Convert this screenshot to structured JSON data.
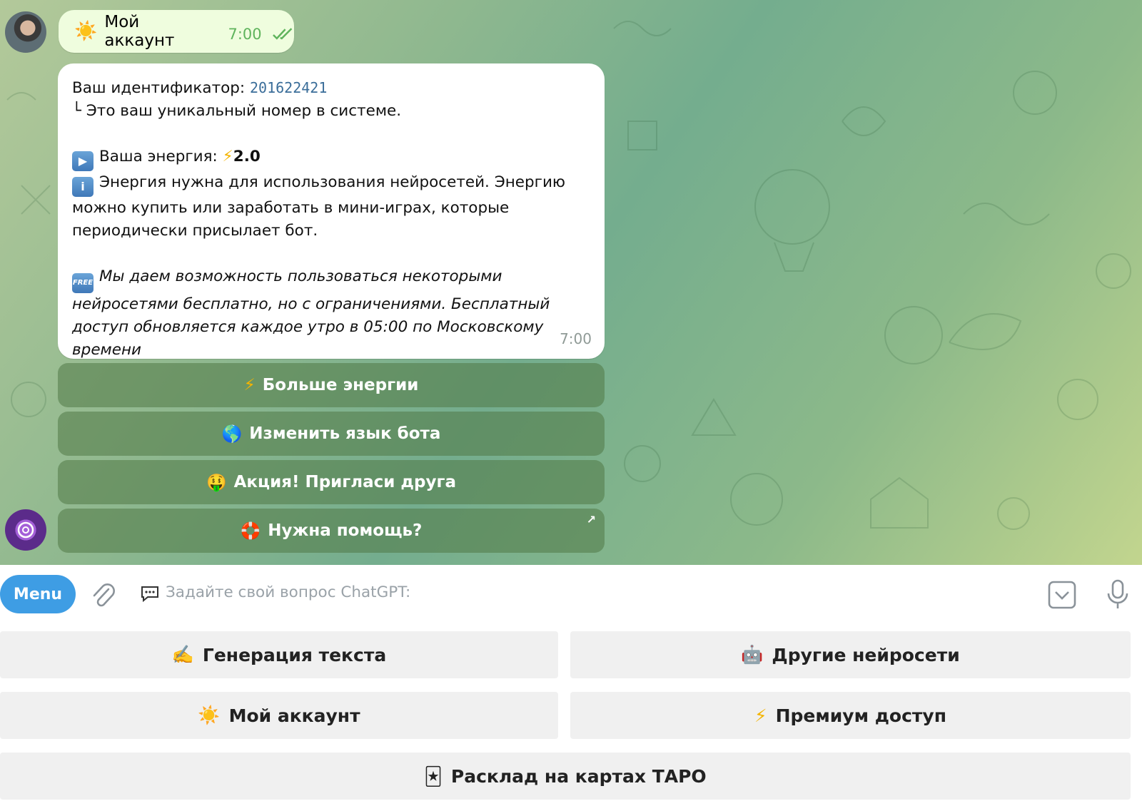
{
  "outgoing": {
    "emoji": "☀️",
    "text": "Мой аккаунт",
    "time": "7:00"
  },
  "incoming": {
    "id_label": "Ваш идентификатор:",
    "id_value": "201622421",
    "id_note": "└ Это ваш уникальный номер в системе.",
    "energy_icon": "▶",
    "energy_label": "Ваша энергия:",
    "energy_value": "2.0",
    "info_icon": "i",
    "info_line1": "Энергия нужна для использования нейросетей. Энергию",
    "info_line2": "можно купить или заработать в мини-играх, которые",
    "info_line3": "периодически присылает бот.",
    "free_icon": "FREE",
    "free_line1": "Мы даем возможность пользоваться некоторыми",
    "free_line2": "нейросетями бесплатно, но с ограничениями. Бесплатный",
    "free_line3": "доступ обновляется каждое утро в 05:00 по Московскому",
    "free_line4": "времени",
    "time": "7:00"
  },
  "inline_buttons": [
    {
      "emoji": "⚡",
      "label": "Больше энергии"
    },
    {
      "emoji": "🌎",
      "label": "Изменить язык бота"
    },
    {
      "emoji": "🤑",
      "label": "Акция! Пригласи друга"
    },
    {
      "emoji": "🛟",
      "label": "Нужна помощь?",
      "link_arrow": "↗"
    }
  ],
  "composer": {
    "menu_label": "Menu",
    "placeholder": "Задайте свой вопрос ChatGPT:"
  },
  "reply_keyboard": [
    {
      "emoji": "✍️",
      "label": "Генерация текста"
    },
    {
      "emoji": "🤖",
      "label": "Другие нейросети"
    },
    {
      "emoji": "☀️",
      "label": "Мой аккаунт"
    },
    {
      "emoji": "⚡",
      "label": "Премиум доступ"
    },
    {
      "emoji": "🃏",
      "label": "Расклад на картах ТАРО"
    }
  ],
  "colors": {
    "accent": "#3e9de4",
    "outgoing_bubble": "#effdde",
    "id_link": "#3a6d99"
  }
}
